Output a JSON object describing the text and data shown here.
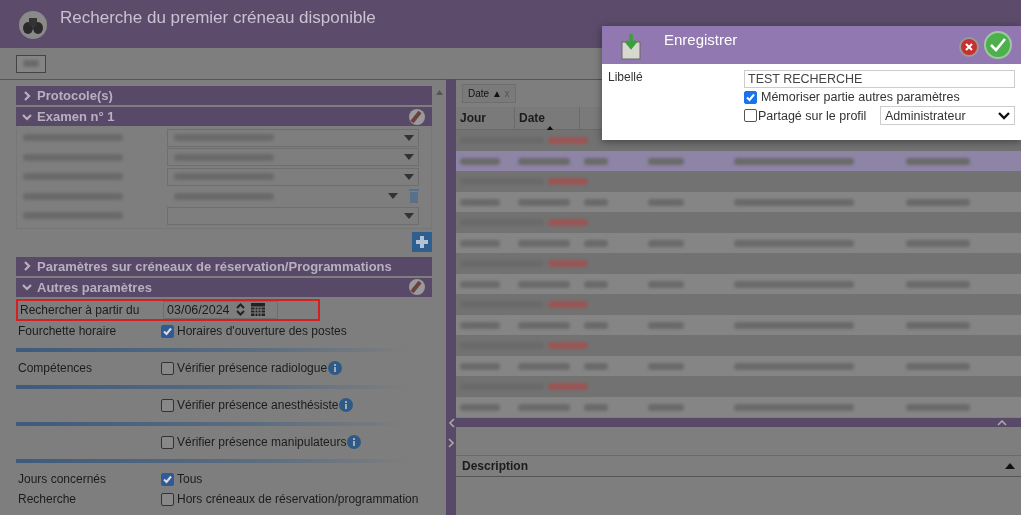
{
  "window": {
    "title": "Recherche du premier créneau disponible"
  },
  "sections": [
    {
      "title": "Protocole(s)",
      "expanded": false
    },
    {
      "title": "Examen n° 1",
      "expanded": true
    }
  ],
  "exam_fields": [
    {
      "kind": "select"
    },
    {
      "kind": "select"
    },
    {
      "kind": "select"
    },
    {
      "kind": "select-extra"
    },
    {
      "kind": "empty"
    }
  ],
  "params_section": {
    "title": "Paramètres sur créneaux de réservation/Programmations",
    "expanded": false
  },
  "other_section": {
    "title": "Autres paramètres",
    "expanded": true
  },
  "date_row": {
    "label": "Rechercher à partir du",
    "value": "03/06/2024",
    "highlighted": true
  },
  "options": [
    {
      "label": "Fourchette horaire",
      "text": "Horaires d'ouverture des postes",
      "checked": true,
      "info": false,
      "divider": true
    },
    {
      "label": "Compétences",
      "text": "Vérifier présence radiologue",
      "checked": false,
      "info": true,
      "divider": true
    },
    {
      "text": "Vérifier présence anesthésiste",
      "checked": false,
      "info": true,
      "divider": true
    },
    {
      "text": "Vérifier présence manipulateurs",
      "checked": false,
      "info": true,
      "divider": true
    },
    {
      "label": "Jours concernés",
      "text": "Tous",
      "checked": true,
      "info": false,
      "divider": false
    },
    {
      "label": "Recherche",
      "text": "Hors créneaux de réservation/programmation",
      "checked": false,
      "info": false,
      "divider": false
    }
  ],
  "grid": {
    "sort_chip": {
      "label": "Date",
      "arrow": "▲",
      "remove": "x"
    },
    "columns": [
      {
        "label": "Jour",
        "sorted": false
      },
      {
        "label": "Date",
        "sorted": true
      }
    ],
    "rows": [
      {
        "kind": "group",
        "selected": false
      },
      {
        "kind": "row",
        "selected": true
      },
      {
        "kind": "group",
        "selected": false
      },
      {
        "kind": "row",
        "selected": false
      },
      {
        "kind": "group",
        "selected": false
      },
      {
        "kind": "row",
        "selected": false
      },
      {
        "kind": "group",
        "selected": false
      },
      {
        "kind": "row",
        "selected": false
      },
      {
        "kind": "group",
        "selected": false
      },
      {
        "kind": "row",
        "selected": false
      },
      {
        "kind": "group",
        "selected": false
      },
      {
        "kind": "row",
        "selected": false
      },
      {
        "kind": "group",
        "selected": false
      },
      {
        "kind": "row",
        "selected": false
      }
    ]
  },
  "description": {
    "title": "Description"
  },
  "dialog": {
    "title": "Enregistrer",
    "label": "Libellé",
    "value": "TEST RECHERCHE",
    "memorize": {
      "text": "Mémoriser partie autres paramètres",
      "checked": true
    },
    "share": {
      "text": "Partagé sur le profil",
      "checked": false
    },
    "profile": "Administrateur"
  }
}
